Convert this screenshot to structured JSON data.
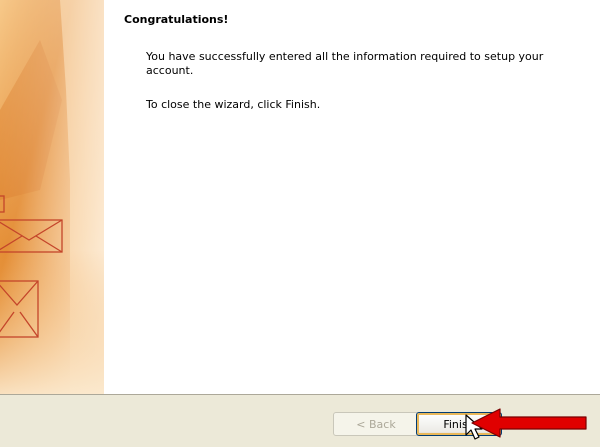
{
  "wizard": {
    "heading": "Congratulations!",
    "message": "You have successfully entered all the information required to setup your account.",
    "close_hint": "To close the wizard, click Finish."
  },
  "buttons": {
    "back_label": "< Back",
    "back_enabled": false,
    "finish_label": "Finish"
  },
  "icons": {
    "side_art": "envelope-icon",
    "pointer": "mouse-cursor-icon",
    "annotation": "red-arrow-icon"
  },
  "colors": {
    "annotation_arrow": "#e00000",
    "art_orange": "#e8903a",
    "button_bar": "#ece9d8"
  }
}
